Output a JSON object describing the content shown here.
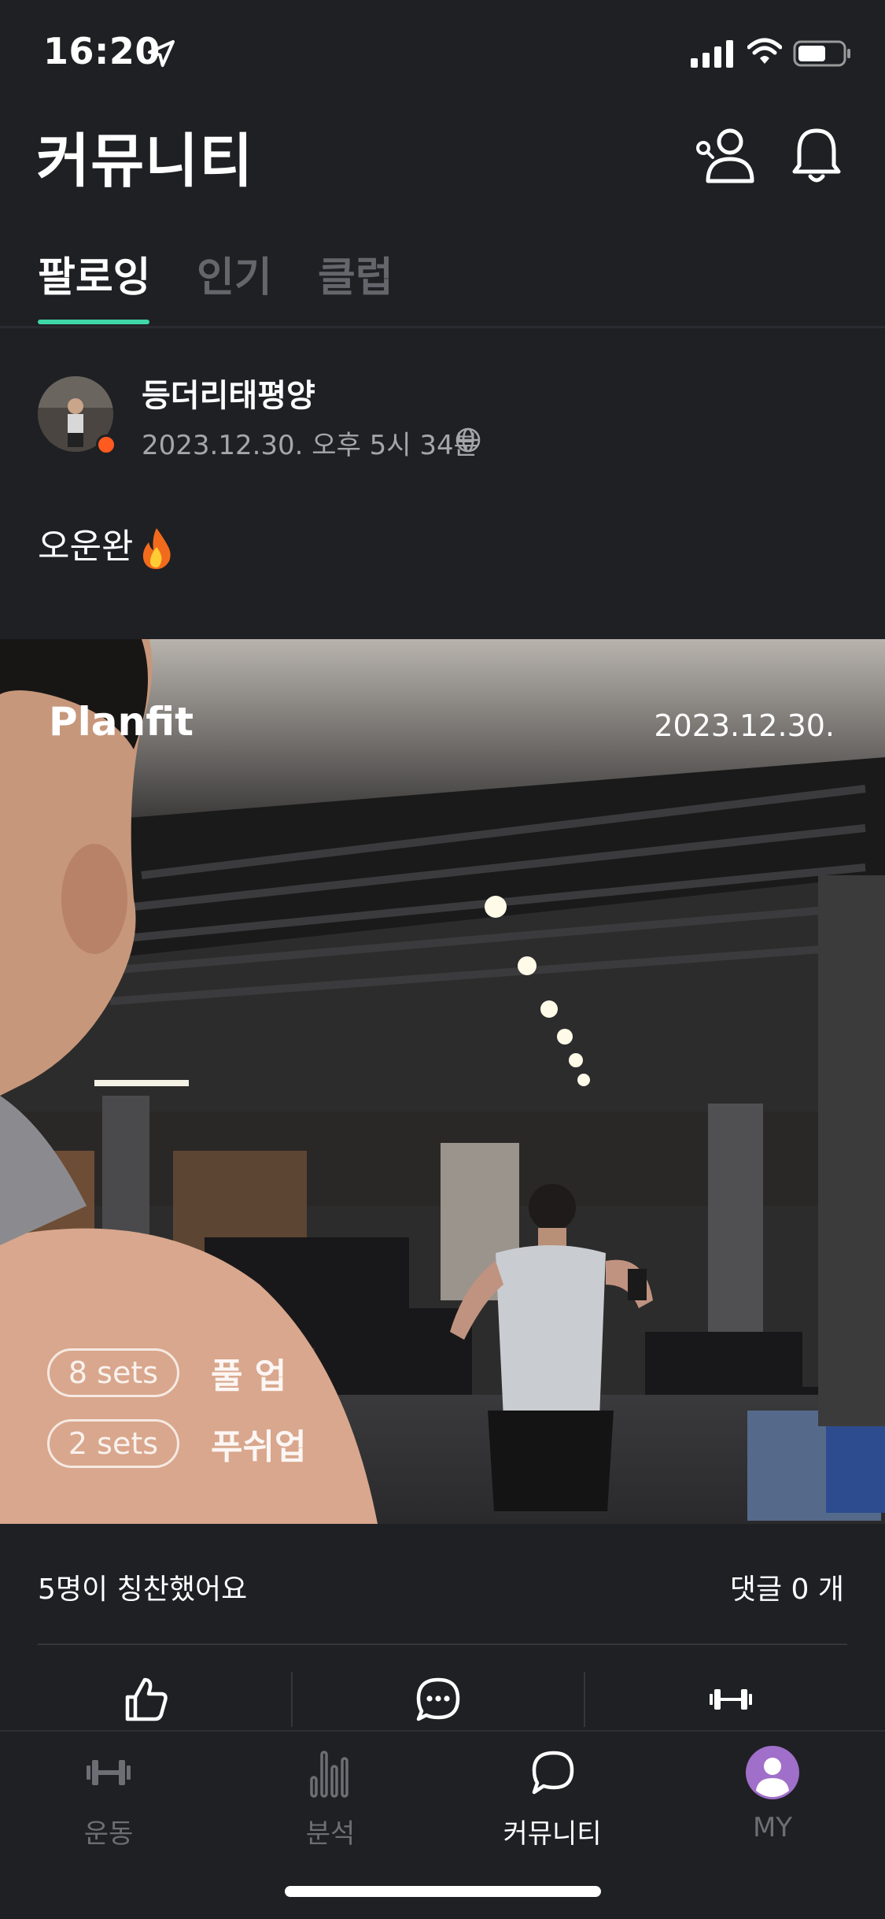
{
  "status_bar": {
    "time": "16:20"
  },
  "header": {
    "title": "커뮤니티"
  },
  "tabs": [
    {
      "label": "팔로잉",
      "active": true
    },
    {
      "label": "인기",
      "active": false
    },
    {
      "label": "클럽",
      "active": false
    }
  ],
  "post": {
    "author": "등더리태평양",
    "date": "2023.12.30. 오후 5시 34분",
    "text": "오운완",
    "photo": {
      "brand": "Planfit",
      "date": "2023.12.30.",
      "exercises": [
        {
          "sets": "8 sets",
          "name": "풀 업"
        },
        {
          "sets": "2 sets",
          "name": "푸쉬업"
        }
      ]
    },
    "cheers": "5명이 칭찬했어요",
    "comments": "댓글 0 개"
  },
  "bottom_nav": [
    {
      "label": "운동",
      "active": false
    },
    {
      "label": "분석",
      "active": false
    },
    {
      "label": "커뮤니티",
      "active": true
    },
    {
      "label": "MY",
      "active": false
    }
  ],
  "colors": {
    "background": "#1f2024",
    "accent": "#3fd7a8",
    "avatar": "#a06fc9"
  }
}
